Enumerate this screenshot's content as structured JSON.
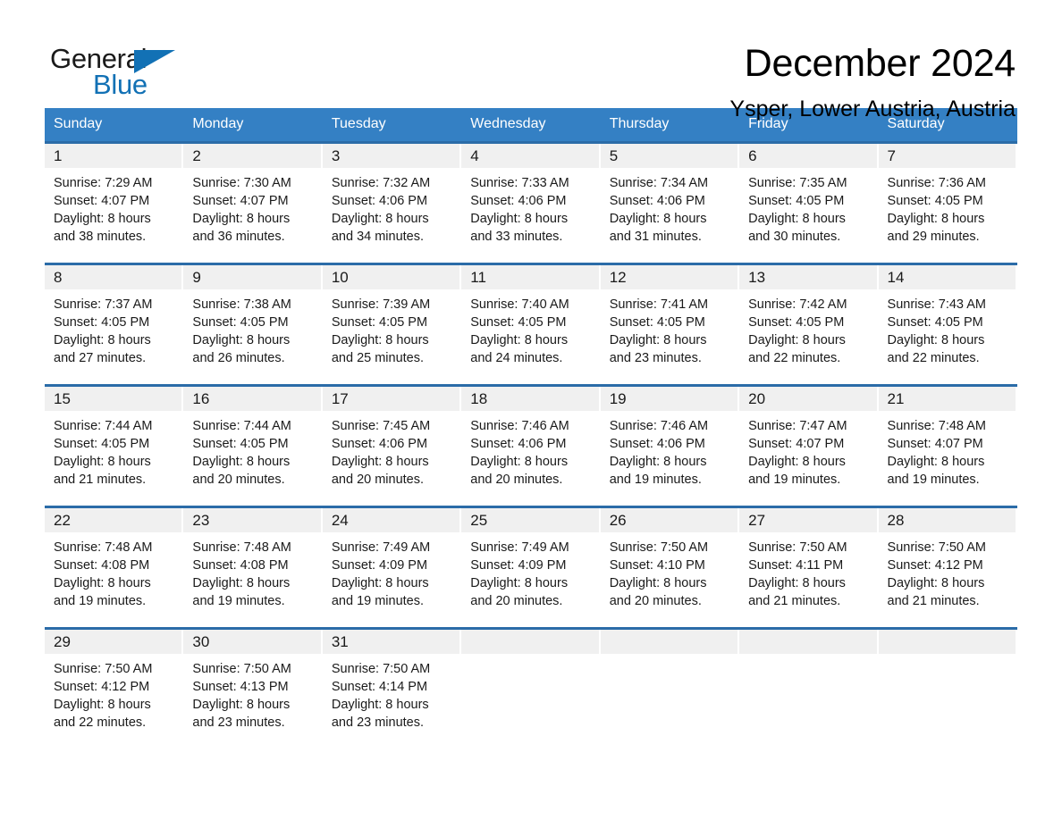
{
  "brand": {
    "name_part1": "General",
    "name_part2": "Blue",
    "flag_icon": "triangle-flag-icon"
  },
  "header": {
    "month_title": "December 2024",
    "location": "Ysper, Lower Austria, Austria"
  },
  "colors": {
    "header_blue": "#3480c4",
    "row_border_blue": "#2b6ca8",
    "brand_blue": "#1271b5",
    "daynum_band": "#f0f0f0",
    "text": "#1a1a1a"
  },
  "weekday_headers": [
    "Sunday",
    "Monday",
    "Tuesday",
    "Wednesday",
    "Thursday",
    "Friday",
    "Saturday"
  ],
  "weeks": [
    [
      {
        "day": "1",
        "sunrise": "Sunrise: 7:29 AM",
        "sunset": "Sunset: 4:07 PM",
        "daylight_line1": "Daylight: 8 hours",
        "daylight_line2": "and 38 minutes."
      },
      {
        "day": "2",
        "sunrise": "Sunrise: 7:30 AM",
        "sunset": "Sunset: 4:07 PM",
        "daylight_line1": "Daylight: 8 hours",
        "daylight_line2": "and 36 minutes."
      },
      {
        "day": "3",
        "sunrise": "Sunrise: 7:32 AM",
        "sunset": "Sunset: 4:06 PM",
        "daylight_line1": "Daylight: 8 hours",
        "daylight_line2": "and 34 minutes."
      },
      {
        "day": "4",
        "sunrise": "Sunrise: 7:33 AM",
        "sunset": "Sunset: 4:06 PM",
        "daylight_line1": "Daylight: 8 hours",
        "daylight_line2": "and 33 minutes."
      },
      {
        "day": "5",
        "sunrise": "Sunrise: 7:34 AM",
        "sunset": "Sunset: 4:06 PM",
        "daylight_line1": "Daylight: 8 hours",
        "daylight_line2": "and 31 minutes."
      },
      {
        "day": "6",
        "sunrise": "Sunrise: 7:35 AM",
        "sunset": "Sunset: 4:05 PM",
        "daylight_line1": "Daylight: 8 hours",
        "daylight_line2": "and 30 minutes."
      },
      {
        "day": "7",
        "sunrise": "Sunrise: 7:36 AM",
        "sunset": "Sunset: 4:05 PM",
        "daylight_line1": "Daylight: 8 hours",
        "daylight_line2": "and 29 minutes."
      }
    ],
    [
      {
        "day": "8",
        "sunrise": "Sunrise: 7:37 AM",
        "sunset": "Sunset: 4:05 PM",
        "daylight_line1": "Daylight: 8 hours",
        "daylight_line2": "and 27 minutes."
      },
      {
        "day": "9",
        "sunrise": "Sunrise: 7:38 AM",
        "sunset": "Sunset: 4:05 PM",
        "daylight_line1": "Daylight: 8 hours",
        "daylight_line2": "and 26 minutes."
      },
      {
        "day": "10",
        "sunrise": "Sunrise: 7:39 AM",
        "sunset": "Sunset: 4:05 PM",
        "daylight_line1": "Daylight: 8 hours",
        "daylight_line2": "and 25 minutes."
      },
      {
        "day": "11",
        "sunrise": "Sunrise: 7:40 AM",
        "sunset": "Sunset: 4:05 PM",
        "daylight_line1": "Daylight: 8 hours",
        "daylight_line2": "and 24 minutes."
      },
      {
        "day": "12",
        "sunrise": "Sunrise: 7:41 AM",
        "sunset": "Sunset: 4:05 PM",
        "daylight_line1": "Daylight: 8 hours",
        "daylight_line2": "and 23 minutes."
      },
      {
        "day": "13",
        "sunrise": "Sunrise: 7:42 AM",
        "sunset": "Sunset: 4:05 PM",
        "daylight_line1": "Daylight: 8 hours",
        "daylight_line2": "and 22 minutes."
      },
      {
        "day": "14",
        "sunrise": "Sunrise: 7:43 AM",
        "sunset": "Sunset: 4:05 PM",
        "daylight_line1": "Daylight: 8 hours",
        "daylight_line2": "and 22 minutes."
      }
    ],
    [
      {
        "day": "15",
        "sunrise": "Sunrise: 7:44 AM",
        "sunset": "Sunset: 4:05 PM",
        "daylight_line1": "Daylight: 8 hours",
        "daylight_line2": "and 21 minutes."
      },
      {
        "day": "16",
        "sunrise": "Sunrise: 7:44 AM",
        "sunset": "Sunset: 4:05 PM",
        "daylight_line1": "Daylight: 8 hours",
        "daylight_line2": "and 20 minutes."
      },
      {
        "day": "17",
        "sunrise": "Sunrise: 7:45 AM",
        "sunset": "Sunset: 4:06 PM",
        "daylight_line1": "Daylight: 8 hours",
        "daylight_line2": "and 20 minutes."
      },
      {
        "day": "18",
        "sunrise": "Sunrise: 7:46 AM",
        "sunset": "Sunset: 4:06 PM",
        "daylight_line1": "Daylight: 8 hours",
        "daylight_line2": "and 20 minutes."
      },
      {
        "day": "19",
        "sunrise": "Sunrise: 7:46 AM",
        "sunset": "Sunset: 4:06 PM",
        "daylight_line1": "Daylight: 8 hours",
        "daylight_line2": "and 19 minutes."
      },
      {
        "day": "20",
        "sunrise": "Sunrise: 7:47 AM",
        "sunset": "Sunset: 4:07 PM",
        "daylight_line1": "Daylight: 8 hours",
        "daylight_line2": "and 19 minutes."
      },
      {
        "day": "21",
        "sunrise": "Sunrise: 7:48 AM",
        "sunset": "Sunset: 4:07 PM",
        "daylight_line1": "Daylight: 8 hours",
        "daylight_line2": "and 19 minutes."
      }
    ],
    [
      {
        "day": "22",
        "sunrise": "Sunrise: 7:48 AM",
        "sunset": "Sunset: 4:08 PM",
        "daylight_line1": "Daylight: 8 hours",
        "daylight_line2": "and 19 minutes."
      },
      {
        "day": "23",
        "sunrise": "Sunrise: 7:48 AM",
        "sunset": "Sunset: 4:08 PM",
        "daylight_line1": "Daylight: 8 hours",
        "daylight_line2": "and 19 minutes."
      },
      {
        "day": "24",
        "sunrise": "Sunrise: 7:49 AM",
        "sunset": "Sunset: 4:09 PM",
        "daylight_line1": "Daylight: 8 hours",
        "daylight_line2": "and 19 minutes."
      },
      {
        "day": "25",
        "sunrise": "Sunrise: 7:49 AM",
        "sunset": "Sunset: 4:09 PM",
        "daylight_line1": "Daylight: 8 hours",
        "daylight_line2": "and 20 minutes."
      },
      {
        "day": "26",
        "sunrise": "Sunrise: 7:50 AM",
        "sunset": "Sunset: 4:10 PM",
        "daylight_line1": "Daylight: 8 hours",
        "daylight_line2": "and 20 minutes."
      },
      {
        "day": "27",
        "sunrise": "Sunrise: 7:50 AM",
        "sunset": "Sunset: 4:11 PM",
        "daylight_line1": "Daylight: 8 hours",
        "daylight_line2": "and 21 minutes."
      },
      {
        "day": "28",
        "sunrise": "Sunrise: 7:50 AM",
        "sunset": "Sunset: 4:12 PM",
        "daylight_line1": "Daylight: 8 hours",
        "daylight_line2": "and 21 minutes."
      }
    ],
    [
      {
        "day": "29",
        "sunrise": "Sunrise: 7:50 AM",
        "sunset": "Sunset: 4:12 PM",
        "daylight_line1": "Daylight: 8 hours",
        "daylight_line2": "and 22 minutes."
      },
      {
        "day": "30",
        "sunrise": "Sunrise: 7:50 AM",
        "sunset": "Sunset: 4:13 PM",
        "daylight_line1": "Daylight: 8 hours",
        "daylight_line2": "and 23 minutes."
      },
      {
        "day": "31",
        "sunrise": "Sunrise: 7:50 AM",
        "sunset": "Sunset: 4:14 PM",
        "daylight_line1": "Daylight: 8 hours",
        "daylight_line2": "and 23 minutes."
      },
      {
        "day": "",
        "sunrise": "",
        "sunset": "",
        "daylight_line1": "",
        "daylight_line2": ""
      },
      {
        "day": "",
        "sunrise": "",
        "sunset": "",
        "daylight_line1": "",
        "daylight_line2": ""
      },
      {
        "day": "",
        "sunrise": "",
        "sunset": "",
        "daylight_line1": "",
        "daylight_line2": ""
      },
      {
        "day": "",
        "sunrise": "",
        "sunset": "",
        "daylight_line1": "",
        "daylight_line2": ""
      }
    ]
  ]
}
